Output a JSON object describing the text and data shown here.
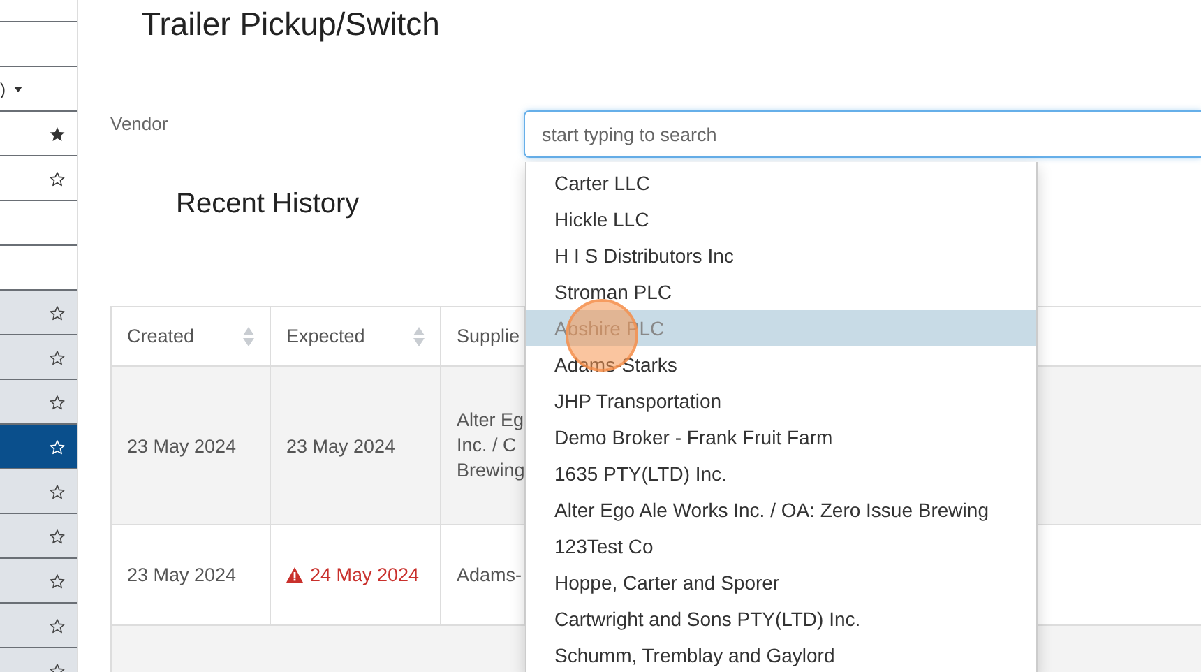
{
  "sidebar": {
    "top_items": [
      {
        "kind": "blank"
      },
      {
        "kind": "blank"
      },
      {
        "kind": "dropdown",
        "label": ")"
      },
      {
        "kind": "star",
        "starred": true
      },
      {
        "kind": "star",
        "starred": false
      },
      {
        "kind": "blank"
      },
      {
        "kind": "blank"
      }
    ],
    "list_items": [
      {
        "starred": false,
        "selected": false
      },
      {
        "starred": false,
        "selected": false
      },
      {
        "starred": false,
        "selected": false
      },
      {
        "starred": false,
        "selected": true
      },
      {
        "starred": false,
        "selected": false
      },
      {
        "starred": false,
        "selected": false
      },
      {
        "starred": false,
        "selected": false
      },
      {
        "starred": false,
        "selected": false
      },
      {
        "starred": false,
        "selected": false
      }
    ]
  },
  "page": {
    "title": "Trailer Pickup/Switch"
  },
  "vendor": {
    "label": "Vendor",
    "placeholder": "start typing to search"
  },
  "recent_history": {
    "title": "Recent History",
    "columns": [
      {
        "label": "Created",
        "sortable": true
      },
      {
        "label": "Expected",
        "sortable": true
      },
      {
        "label": "Supplie",
        "sortable": false
      }
    ],
    "rows": [
      {
        "created": "23 May 2024",
        "expected": "23 May 2024",
        "late": false,
        "supplier_lines": [
          "Alter Eg",
          "Inc. / C",
          "Brewing"
        ]
      },
      {
        "created": "23 May 2024",
        "expected": "24 May 2024",
        "late": true,
        "supplier_lines": [
          "Adams-"
        ]
      }
    ]
  },
  "vendor_dropdown": {
    "options": [
      {
        "label": "Carter LLC",
        "selected": false
      },
      {
        "label": "Hickle LLC",
        "selected": false
      },
      {
        "label": "H I S Distributors Inc",
        "selected": false
      },
      {
        "label": "Stroman PLC",
        "selected": false
      },
      {
        "label": "Abshire PLC",
        "selected": true
      },
      {
        "label": "Adams-Starks",
        "selected": false
      },
      {
        "label": "JHP Transportation",
        "selected": false
      },
      {
        "label": "Demo Broker - Frank Fruit Farm",
        "selected": false
      },
      {
        "label": "1635 PTY(LTD) Inc.",
        "selected": false
      },
      {
        "label": "Alter Ego Ale Works Inc. / OA: Zero Issue Brewing",
        "selected": false
      },
      {
        "label": "123Test Co",
        "selected": false
      },
      {
        "label": "Hoppe, Carter and Sporer",
        "selected": false
      },
      {
        "label": "Cartwright and Sons PTY(LTD) Inc.",
        "selected": false
      },
      {
        "label": "Schumm, Tremblay and Gaylord",
        "selected": false
      }
    ]
  }
}
